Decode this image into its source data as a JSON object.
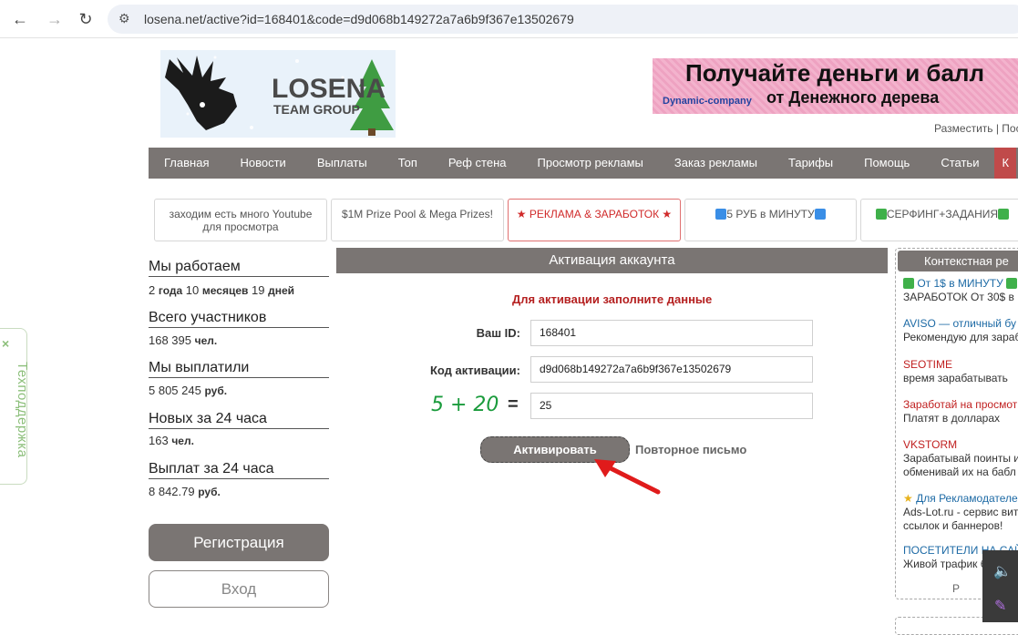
{
  "browser": {
    "url": "losena.net/active?id=168401&code=d9d068b149272a7a6b9f367e13502679"
  },
  "support": {
    "close": "×",
    "label": "Техподдержка"
  },
  "logo": {
    "title": "LOSENA",
    "subtitle": "TEAM GROUP"
  },
  "banner": {
    "headline": "Получайте деньги и балл",
    "company": "Dynamic-company",
    "subline": "от Денежного дерева"
  },
  "top_links": "Разместить | Пос",
  "menu": [
    "Главная",
    "Новости",
    "Выплаты",
    "Топ",
    "Реф стена",
    "Просмотр рекламы",
    "Заказ рекламы",
    "Тарифы",
    "Помощь",
    "Статьи",
    "К"
  ],
  "tiles": [
    {
      "text": "заходим есть много Youtube для просмотра"
    },
    {
      "text": "$1M Prize Pool & Mega Prizes!"
    },
    {
      "text": "★ РЕКЛАМА & ЗАРАБОТОК ★"
    },
    {
      "text": "5 РУБ в МИНУТУ"
    },
    {
      "text": "СЕРФИНГ+ЗАДАНИЯ"
    }
  ],
  "stats": {
    "working": {
      "label": "Мы работаем",
      "v1": "2",
      "u1": "года",
      "v2": "10",
      "u2": "месяцев",
      "v3": "19",
      "u3": "дней"
    },
    "members": {
      "label": "Всего участников",
      "value": "168 395",
      "unit": "чел."
    },
    "paid": {
      "label": "Мы выплатили",
      "value": "5 805 245",
      "unit": "руб."
    },
    "new24": {
      "label": "Новых за 24 часа",
      "value": "163",
      "unit": "чел."
    },
    "payouts24": {
      "label": "Выплат за 24 часа",
      "value": "8 842.79",
      "unit": "руб."
    }
  },
  "auth": {
    "register": "Регистрация",
    "login": "Вход"
  },
  "form": {
    "title": "Активация аккаунта",
    "note": "Для активации заполните данные",
    "id_label": "Ваш ID:",
    "id_value": "168401",
    "code_label": "Код активации:",
    "code_value": "d9d068b149272a7a6b9f367e13502679",
    "captcha": "5 + 20",
    "captcha_eq": "=",
    "captcha_value": "25",
    "submit": "Активировать",
    "resend": "Повторное письмо"
  },
  "context": {
    "title": "Контекстная ре",
    "items": [
      {
        "link": "От 1$ в МИНУТУ",
        "desc": "ЗАРАБОТОК От 30$ в",
        "red": false
      },
      {
        "link": "AVISO — отличный бу",
        "desc": "Рекомендую для зараб",
        "red": false
      },
      {
        "link": "SEOTIME",
        "desc": "время зарабатывать",
        "red": true
      },
      {
        "link": "Заработай на просмот",
        "desc": "Платят в долларах",
        "red": true
      },
      {
        "link": "VKSTORM",
        "desc": "Зарабатывай поинты и",
        "desc2": "обменивай их на  бабл",
        "red": true
      },
      {
        "link": "Для Рекламодателе",
        "desc": "Ads-Lot.ru - сервис вит",
        "desc2": "ссылок и баннеров!",
        "red": false
      },
      {
        "link": "ПОСЕТИТЕЛИ НА САЙ",
        "desc": "Живой трафик б",
        "red": false
      }
    ],
    "more": "Р"
  }
}
